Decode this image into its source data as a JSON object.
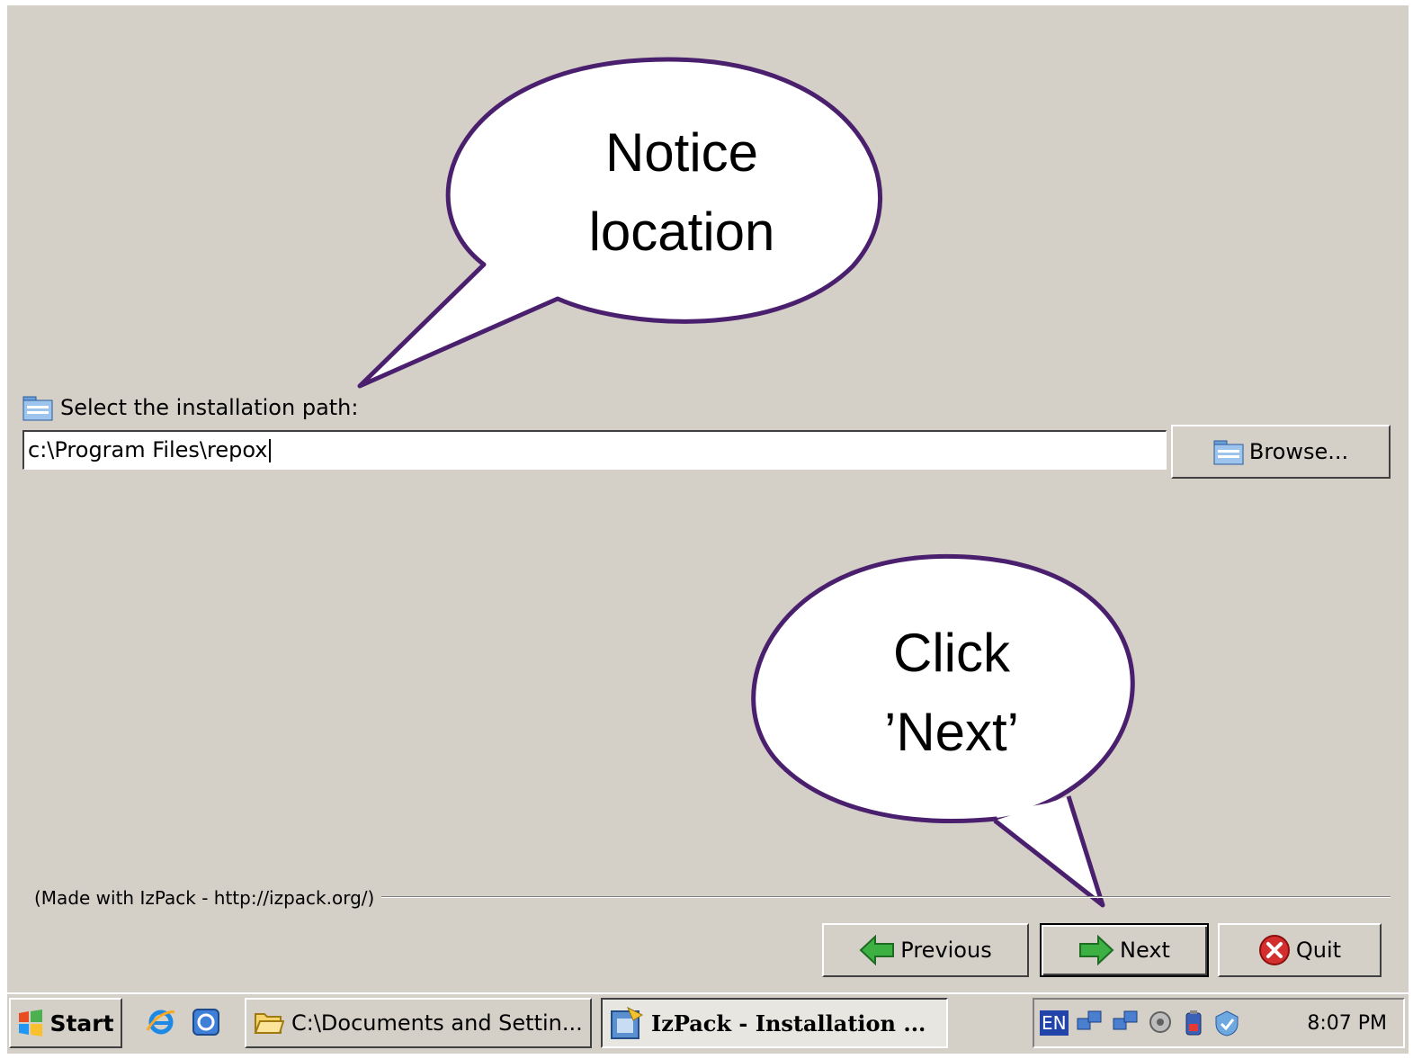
{
  "installer": {
    "path_label": "Select the installation path:",
    "path_value": "c:\\Program Files\\repox",
    "browse_label": "Browse...",
    "made_with": "(Made with IzPack - http://izpack.org/)",
    "buttons": {
      "previous": "Previous",
      "next": "Next",
      "quit": "Quit"
    }
  },
  "callouts": {
    "top": {
      "line1": "Notice",
      "line2": "location"
    },
    "bottom": {
      "line1": "Click",
      "line2": "’Next’"
    }
  },
  "taskbar": {
    "start": "Start",
    "tasks": [
      {
        "label": "C:\\Documents and Settin..."
      },
      {
        "label": "IzPack - Installation ..."
      }
    ],
    "language": "EN",
    "clock": "8:07 PM"
  },
  "colors": {
    "window_bg": "#d4d0c8",
    "callout_border": "#4a1f6e",
    "arrow_green": "#3cb043",
    "quit_red": "#d32f2f"
  }
}
